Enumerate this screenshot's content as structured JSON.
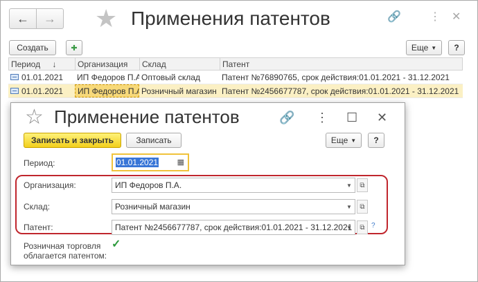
{
  "window": {
    "title": "Применения патентов",
    "create_label": "Создать",
    "more_label": "Еще",
    "help_label": "?"
  },
  "table": {
    "columns": [
      "Период",
      "Организация",
      "Склад",
      "Патент"
    ],
    "sort_indicator": "↓",
    "rows": [
      {
        "period": "01.01.2021",
        "org": "ИП Федоров П.А.",
        "warehouse": "Оптовый склад",
        "patent": "Патент №76890765, срок действия:01.01.2021 - 31.12.2021",
        "selected": false
      },
      {
        "period": "01.01.2021",
        "org": "ИП Федоров П.А.",
        "warehouse": "Розничный магазин",
        "patent": "Патент №2456677787, срок действия:01.01.2021 - 31.12.2021",
        "selected": true
      }
    ]
  },
  "dialog": {
    "title": "Применение патентов",
    "save_close_label": "Записать и закрыть",
    "save_label": "Записать",
    "more_label": "Еще",
    "help_label": "?",
    "period_label": "Период:",
    "period_value": "01.01.2021",
    "org_label": "Организация:",
    "org_value": "ИП Федоров П.А.",
    "warehouse_label": "Склад:",
    "warehouse_value": "Розничный магазин",
    "patent_label": "Патент:",
    "patent_value": "Патент №2456677787, срок действия:01.01.2021 - 31.12.2021",
    "retail_label_line1": "Розничная торговля",
    "retail_label_line2": "облагается патентом:",
    "retail_checked": true
  },
  "colors": {
    "accent_yellow": "#f2cf1c",
    "highlight_frame": "#c0262d",
    "selected_row": "#fbf0c4"
  }
}
